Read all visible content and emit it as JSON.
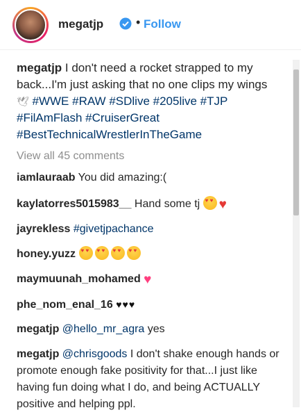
{
  "header": {
    "username": "megatjp",
    "separator": "•",
    "follow_label": "Follow"
  },
  "caption": {
    "username": "megatjp",
    "text": " I don't need a rocket strapped to my back...I'm just asking that no one clips my wings ",
    "wing_emoji": "🕊",
    "hashtags": " #WWE #RAW #SDlive #205live #TJP #FilAmFlash #CruiserGreat #BestTechnicalWrestlerInTheGame"
  },
  "view_all": "View all 45 comments",
  "comments": [
    {
      "username": "iamlauraab",
      "text": " You did amazing:("
    },
    {
      "username": "kaylatorres5015983__",
      "text": " Hand some tj "
    },
    {
      "username": "jayrekless",
      "text": " #givetjpachance"
    },
    {
      "username": "honey.yuzz",
      "text": " "
    },
    {
      "username": "maymuunah_mohamed",
      "text": " "
    },
    {
      "username": "phe_nom_enal_16",
      "text": " ",
      "hearts": "♥♥♥"
    },
    {
      "username": "megatjp",
      "mention": " @hello_mr_agra",
      "text": " yes"
    },
    {
      "username": "megatjp",
      "mention": " @chrisgoods",
      "text": " I don't shake enough hands or promote enough fake positivity for that...I just like having fun doing what I do, and being ACTUALLY positive and helping ppl."
    }
  ],
  "colors": {
    "link": "#3897f0",
    "hashtag": "#003569",
    "muted": "#8e8e8e",
    "text": "#262626"
  }
}
